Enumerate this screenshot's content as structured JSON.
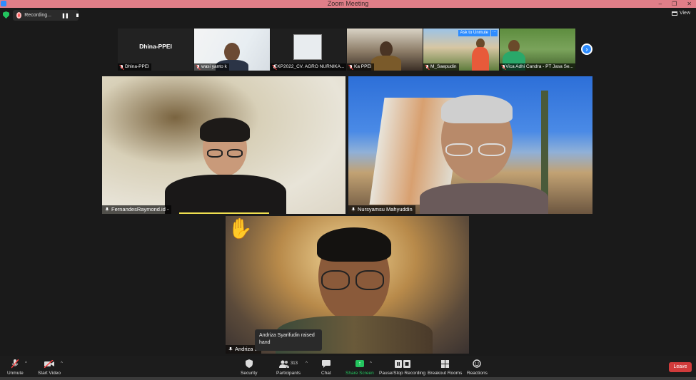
{
  "window": {
    "title": "Zoom Meeting",
    "min": "–",
    "max": "❐",
    "close": "✕"
  },
  "topbar": {
    "recording_label": "Recording...",
    "pause_glyph": "❚❚",
    "view_label": "View"
  },
  "thumbnails": [
    {
      "name": "Dhina-PPEI",
      "label": "Dhina-PPEI"
    },
    {
      "name": "wasi yanto k"
    },
    {
      "name": "EKP2022_CV. AGRO NURNIKA..."
    },
    {
      "name": "Ka PPEI"
    },
    {
      "name": "M_Saepudin",
      "ask_unmute": "Ask to Unmute",
      "more": "···"
    },
    {
      "name": "Vica Adhi Candra - PT Jasa Se..."
    }
  ],
  "strip_next": "›",
  "tiles": {
    "left": {
      "name": "FernandesRaymond.id -"
    },
    "right": {
      "name": "Nursyamsu Mahyuddin"
    },
    "bottom": {
      "name": "Andriza S"
    }
  },
  "raise_hand_icon": "✋",
  "tooltip": "Andriza Syarifudin raised hand",
  "toolbar": {
    "unmute": "Unmute",
    "start_video": "Start Video",
    "security": "Security",
    "participants": "Participants",
    "participants_count": "313",
    "chat": "Chat",
    "share_screen": "Share Screen",
    "pause_recording": "Pause/Stop Recording",
    "breakout": "Breakout Rooms",
    "reactions": "Reactions",
    "leave": "Leave",
    "caret": "^"
  },
  "colors": {
    "accent": "#2d8cff",
    "leave": "#d13b3b",
    "share": "#23c45e",
    "titlebar": "#e07e88"
  }
}
